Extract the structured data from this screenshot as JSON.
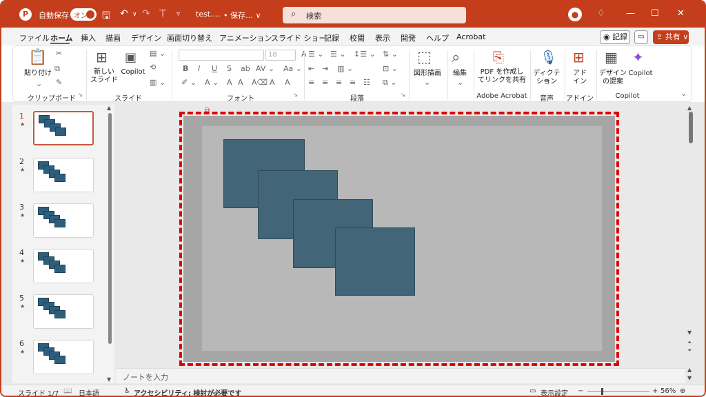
{
  "titlebar": {
    "autosave_label": "自動保存",
    "toggle_label": "オン",
    "file_name": "test.…",
    "save_status": "• 保存… ∨",
    "search_placeholder": "検索"
  },
  "menu": {
    "tabs": [
      "ファイル",
      "ホーム",
      "挿入",
      "描画",
      "デザイン",
      "画面切り替え",
      "アニメーション",
      "スライド ショー",
      "記録",
      "校閲",
      "表示",
      "開発",
      "ヘルプ",
      "Acrobat"
    ],
    "active_tab": "ホーム",
    "record_label": "記録",
    "share_label": "共有"
  },
  "ribbon": {
    "paste": "貼り付け",
    "new_slide_line1": "新しい",
    "new_slide_line2": "スライド",
    "copilot": "Copilot",
    "font_size": "18",
    "shape_draw": "図形描画",
    "edit": "編集",
    "pdf_line1": "PDF を作成し",
    "pdf_line2": "てリンクを共有",
    "dictate_line1": "ディクテー",
    "dictate_line2": "ション",
    "addin_line1": "アド",
    "addin_line2": "イン",
    "designer_line1": "デザイン",
    "designer_line2": "の提案",
    "copilot2": "Copilot",
    "groups": {
      "clipboard": "クリップボード",
      "slides": "スライド",
      "font": "フォント",
      "paragraph": "段落",
      "adobe": "Adobe Acrobat",
      "voice": "音声",
      "addins": "アドイン",
      "copilot": "Copilot"
    }
  },
  "thumbnails": [
    "1",
    "2",
    "3",
    "4",
    "5",
    "6"
  ],
  "notes_placeholder": "ノートを入力",
  "status": {
    "slide_info": "スライド 1/7",
    "language": "日本語",
    "accessibility": "アクセシビリティ: 検討が必要です",
    "display_settings": "表示設定",
    "zoom": "56%"
  },
  "colors": {
    "accent": "#c43e1c",
    "shape_fill": "#426577",
    "selection_dash": "#e00000"
  }
}
